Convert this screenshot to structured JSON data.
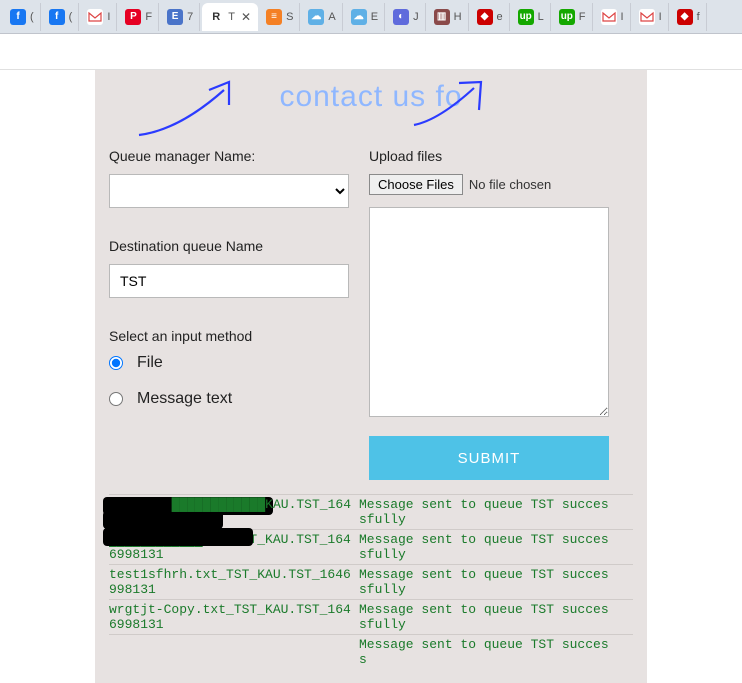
{
  "tabs": [
    {
      "label": "(",
      "icon": "fb"
    },
    {
      "label": "(",
      "icon": "fb"
    },
    {
      "label": "I",
      "icon": "gm"
    },
    {
      "label": "F",
      "icon": "pn"
    },
    {
      "label": "7",
      "icon": "ed"
    },
    {
      "label": "T",
      "icon": "R",
      "active": true
    },
    {
      "label": "S",
      "icon": "so"
    },
    {
      "label": "A",
      "icon": "sf"
    },
    {
      "label": "E",
      "icon": "sf"
    },
    {
      "label": "J",
      "icon": "gh"
    },
    {
      "label": "H",
      "icon": "ot"
    },
    {
      "label": "e",
      "icon": "rd"
    },
    {
      "label": "L",
      "icon": "up"
    },
    {
      "label": "F",
      "icon": "up"
    },
    {
      "label": "I",
      "icon": "gm"
    },
    {
      "label": "I",
      "icon": "gm"
    },
    {
      "label": "f",
      "icon": "rd"
    }
  ],
  "heading": "contact us fo",
  "labels": {
    "queueManager": "Queue manager Name:",
    "uploadFiles": "Upload files",
    "destQueue": "Destination queue Name",
    "inputMethod": "Select an input method",
    "file": "File",
    "messageText": "Message text",
    "chooseFiles": "Choose Files",
    "noFile": "No file chosen",
    "submit": "SUBMIT"
  },
  "values": {
    "destQueue": "TST",
    "inputMethod": "file"
  },
  "log": [
    {
      "a": "████████████KAU.TST_164",
      "b": "Message sent to queue TST successfully",
      "redactA": true
    },
    {
      "a": "████████████txt_TST_KAU.TST_1646998131",
      "b": "Message sent to queue TST successfully",
      "redactA": true
    },
    {
      "a": "test1sfhrh.txt_TST_KAU.TST_1646998131",
      "b": "Message sent to queue TST successfully"
    },
    {
      "a": "wrgtjt-Copy.txt_TST_KAU.TST_1646998131",
      "b": "Message sent to queue TST successfully"
    },
    {
      "a": "",
      "b": "Message sent to queue TST success"
    }
  ]
}
